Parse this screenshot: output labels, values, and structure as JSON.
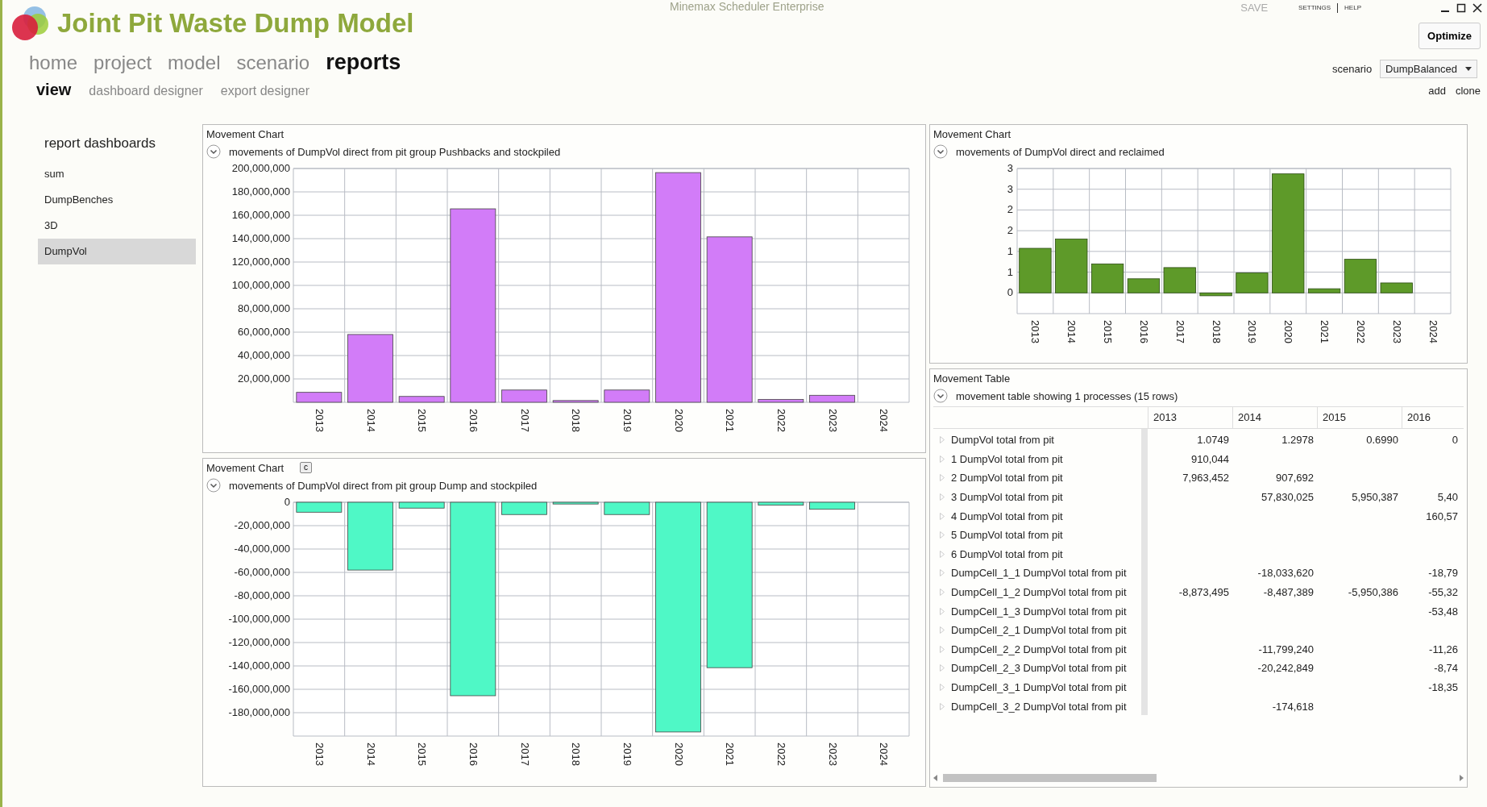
{
  "app": {
    "title": "Joint Pit Waste Dump Model",
    "product": "Minemax Scheduler Enterprise"
  },
  "top_links": {
    "save": "SAVE",
    "settings": "SETTINGS",
    "help": "HELP"
  },
  "optimize_button": "Optimize",
  "nav": [
    {
      "label": "home",
      "selected": false
    },
    {
      "label": "project",
      "selected": false
    },
    {
      "label": "model",
      "selected": false
    },
    {
      "label": "scenario",
      "selected": false
    },
    {
      "label": "reports",
      "selected": true
    }
  ],
  "subnav": [
    {
      "label": "view",
      "selected": true
    },
    {
      "label": "dashboard designer",
      "selected": false
    },
    {
      "label": "export designer",
      "selected": false
    }
  ],
  "scenario": {
    "label": "scenario",
    "value": "DumpBalanced"
  },
  "scenario_actions": [
    "add",
    "clone"
  ],
  "sidebar": {
    "title": "report dashboards",
    "items": [
      {
        "label": "sum",
        "selected": false
      },
      {
        "label": "DumpBenches",
        "selected": false
      },
      {
        "label": "3D",
        "selected": false
      },
      {
        "label": "DumpVol",
        "selected": true
      }
    ]
  },
  "left_panels": [
    {
      "title": "Movement Chart",
      "subtitle": "movements of DumpVol direct from pit group Pushbacks and stockpiled",
      "chart_data": {
        "type": "bar",
        "grid": true,
        "categories": [
          "2013",
          "2014",
          "2015",
          "2016",
          "2017",
          "2018",
          "2019",
          "2020",
          "2021",
          "2022",
          "2023",
          "2024"
        ],
        "ylim": [
          0,
          200000000
        ],
        "yticks": [
          {
            "value": 20000000,
            "label": "20,000,000"
          },
          {
            "value": 40000000,
            "label": "40,000,000"
          },
          {
            "value": 60000000,
            "label": "60,000,000"
          },
          {
            "value": 80000000,
            "label": "80,000,000"
          },
          {
            "value": 100000000,
            "label": "100,000,000"
          },
          {
            "value": 120000000,
            "label": "120,000,000"
          },
          {
            "value": 140000000,
            "label": "140,000,000"
          },
          {
            "value": 160000000,
            "label": "160,000,000"
          },
          {
            "value": 180000000,
            "label": "180,000,000"
          },
          {
            "value": 200000000,
            "label": "200,000,000"
          }
        ],
        "series": [
          {
            "color": "#d27cf8",
            "values": [
              8500000,
              58000000,
              5000000,
              165500000,
              10500000,
              1500000,
              10500000,
              196500000,
              141500000,
              2500000,
              6000000,
              null
            ]
          }
        ]
      }
    },
    {
      "title": "Movement Chart",
      "button": "c",
      "subtitle": "movements of DumpVol direct from pit group Dump and stockpiled",
      "chart_data": {
        "type": "bar",
        "grid": true,
        "categories": [
          "2013",
          "2014",
          "2015",
          "2016",
          "2017",
          "2018",
          "2019",
          "2020",
          "2021",
          "2022",
          "2023",
          "2024"
        ],
        "ylim": [
          -200000000,
          0
        ],
        "yticks": [
          {
            "value": 0,
            "label": "0"
          },
          {
            "value": -20000000,
            "label": "-20,000,000"
          },
          {
            "value": -40000000,
            "label": "-40,000,000"
          },
          {
            "value": -60000000,
            "label": "-60,000,000"
          },
          {
            "value": -80000000,
            "label": "-80,000,000"
          },
          {
            "value": -100000000,
            "label": "-100,000,000"
          },
          {
            "value": -120000000,
            "label": "-120,000,000"
          },
          {
            "value": -140000000,
            "label": "-140,000,000"
          },
          {
            "value": -160000000,
            "label": "-160,000,000"
          },
          {
            "value": -180000000,
            "label": "-180,000,000"
          }
        ],
        "series": [
          {
            "color": "#4ff8c6",
            "values": [
              -8500000,
              -58000000,
              -5000000,
              -165500000,
              -10500000,
              -1500000,
              -10500000,
              -196500000,
              -141500000,
              -2500000,
              -6000000,
              null
            ]
          }
        ]
      }
    }
  ],
  "right_chart": {
    "title": "Movement Chart",
    "subtitle": "movements of DumpVol direct and reclaimed",
    "chart_data": {
      "type": "bar",
      "grid": true,
      "categories": [
        "2013",
        "2014",
        "2015",
        "2016",
        "2017",
        "2018",
        "2019",
        "2020",
        "2021",
        "2022",
        "2023",
        "2024"
      ],
      "ylim": [
        -0.5,
        3
      ],
      "yticks": [
        {
          "value": 0,
          "label": "0"
        },
        {
          "value": 0.5,
          "label": "1"
        },
        {
          "value": 1,
          "label": "1"
        },
        {
          "value": 1.5,
          "label": "2"
        },
        {
          "value": 2,
          "label": "2"
        },
        {
          "value": 2.5,
          "label": "3"
        },
        {
          "value": 3,
          "label": "3"
        }
      ],
      "series": [
        {
          "color": "#5e9a29",
          "values": [
            1.0749,
            1.2978,
            0.699,
            0.34,
            0.61,
            -0.07,
            0.48,
            2.87,
            0.1,
            0.81,
            0.24,
            null
          ]
        }
      ]
    }
  },
  "movement_table": {
    "title": "Movement Table",
    "subtitle": "movement table showing 1 processes (15 rows)",
    "columns": [
      "2013",
      "2014",
      "2015",
      "2016"
    ],
    "rows": [
      {
        "label": "DumpVol total from pit",
        "cells": [
          "1.0749",
          "1.2978",
          "0.6990",
          "0"
        ]
      },
      {
        "label": "1 DumpVol total from pit",
        "cells": [
          "910,044",
          "",
          "",
          ""
        ]
      },
      {
        "label": "2 DumpVol total from pit",
        "cells": [
          "7,963,452",
          "907,692",
          "",
          ""
        ]
      },
      {
        "label": "3 DumpVol total from pit",
        "cells": [
          "",
          "57,830,025",
          "5,950,387",
          "5,40"
        ]
      },
      {
        "label": "4 DumpVol total from pit",
        "cells": [
          "",
          "",
          "",
          "160,57"
        ]
      },
      {
        "label": "5 DumpVol total from pit",
        "cells": [
          "",
          "",
          "",
          ""
        ]
      },
      {
        "label": "6 DumpVol total from pit",
        "cells": [
          "",
          "",
          "",
          ""
        ]
      },
      {
        "label": "DumpCell_1_1 DumpVol total from pit",
        "cells": [
          "",
          "-18,033,620",
          "",
          "-18,79"
        ]
      },
      {
        "label": "DumpCell_1_2 DumpVol total from pit",
        "cells": [
          "-8,873,495",
          "-8,487,389",
          "-5,950,386",
          "-55,32"
        ]
      },
      {
        "label": "DumpCell_1_3 DumpVol total from pit",
        "cells": [
          "",
          "",
          "",
          "-53,48"
        ]
      },
      {
        "label": "DumpCell_2_1 DumpVol total from pit",
        "cells": [
          "",
          "",
          "",
          ""
        ]
      },
      {
        "label": "DumpCell_2_2 DumpVol total from pit",
        "cells": [
          "",
          "-11,799,240",
          "",
          "-11,26"
        ]
      },
      {
        "label": "DumpCell_2_3 DumpVol total from pit",
        "cells": [
          "",
          "-20,242,849",
          "",
          "-8,74"
        ]
      },
      {
        "label": "DumpCell_3_1 DumpVol total from pit",
        "cells": [
          "",
          "",
          "",
          "-18,35"
        ]
      },
      {
        "label": "DumpCell_3_2 DumpVol total from pit",
        "cells": [
          "",
          "-174,618",
          "",
          ""
        ]
      }
    ]
  }
}
